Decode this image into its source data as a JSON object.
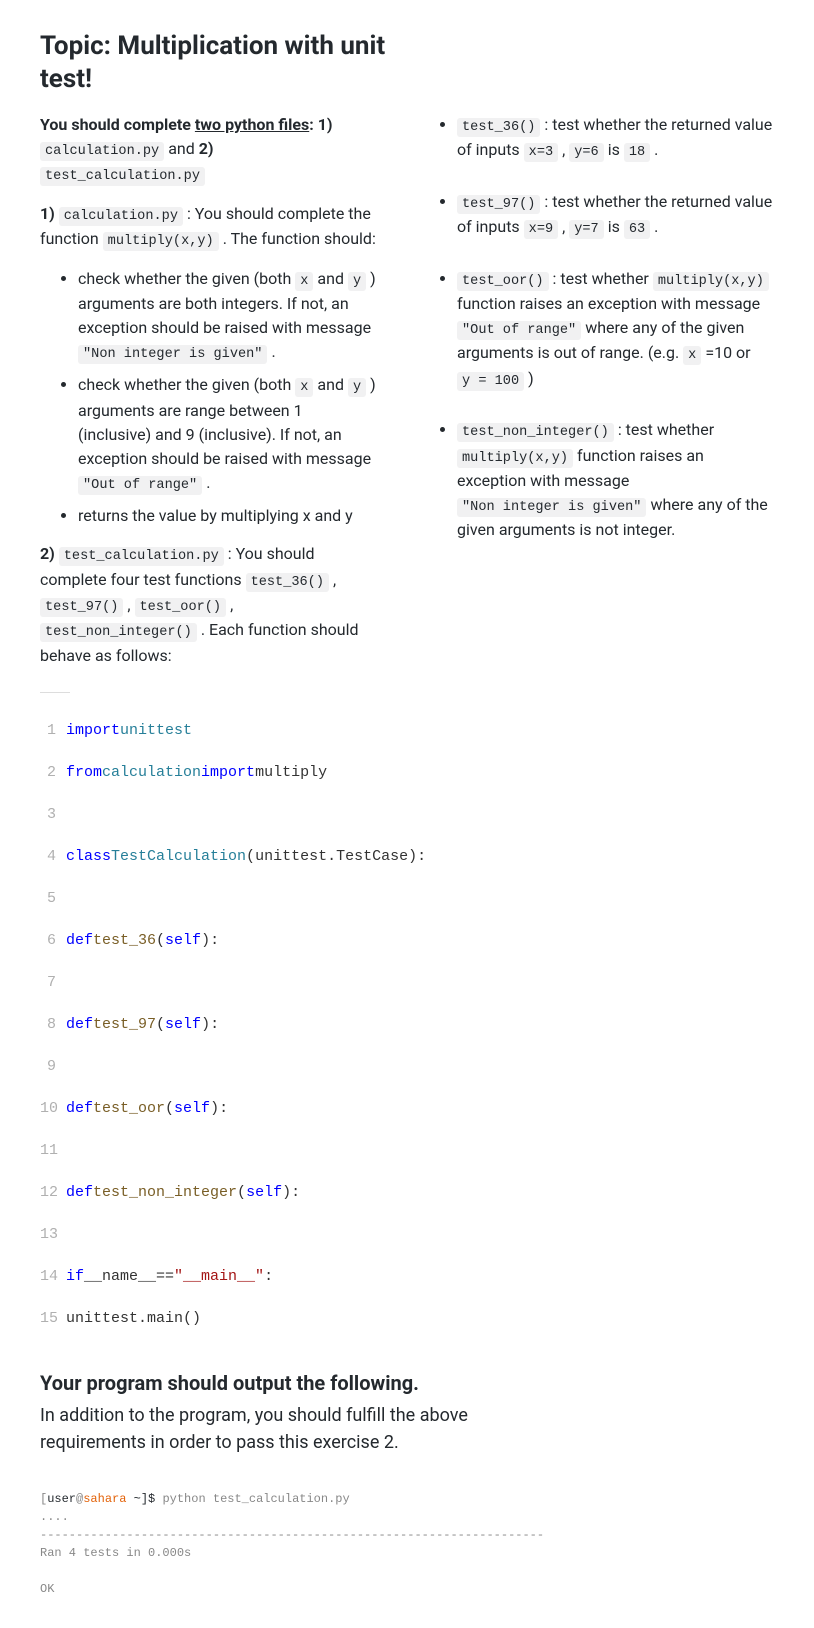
{
  "title": "Topic: Multiplication with unit test!",
  "intro": {
    "pre": "You should complete ",
    "u": "two python files",
    "post": ": 1)",
    "file1": "calculation.py",
    "mid": " and ",
    "post2": "2)",
    "file2": "test_calculation.py"
  },
  "part1": {
    "lead_num": "1)",
    "file": "calculation.py",
    "lead_txt": " : You should complete the function ",
    "fn": "multiply(x,y)",
    "lead_tail": " . The function should:",
    "b1a": "check whether the given (both ",
    "b1x": "x",
    "b1b": " and ",
    "b1y": "y",
    "b1c": " ) arguments are both integers. If not, an exception should be raised with message ",
    "b1msg": "\"Non integer is given\"",
    "b1d": " .",
    "b2a": "check whether the given (both ",
    "b2x": "x",
    "b2b": " and ",
    "b2y": "y",
    "b2c": " ) arguments are range between 1 (inclusive) and 9 (inclusive). If not, an exception should be raised with message ",
    "b2msg": "\"Out of range\"",
    "b2d": " .",
    "b3": "returns the value by multiplying x and y"
  },
  "part2": {
    "lead_num": "2)",
    "file": "test_calculation.py",
    "lead_txt": " : You should complete four test functions ",
    "f1": "test_36()",
    "c1": " , ",
    "f2": "test_97()",
    "c2": " , ",
    "f3": "test_oor()",
    "c3": " , ",
    "f4": "test_non_integer()",
    "tail": " . Each function should behave as follows:"
  },
  "tests": {
    "t1": {
      "name": "test_36()",
      "a": " : test whether the returned value of inputs ",
      "x": "x=3",
      "b": " , ",
      "y": "y=6",
      "c": " is ",
      "r": "18",
      "d": " ."
    },
    "t2": {
      "name": "test_97()",
      "a": " : test whether the returned value of inputs ",
      "x": "x=9",
      "b": " , ",
      "y": "y=7",
      "c": " is ",
      "r": "63",
      "d": " ."
    },
    "t3": {
      "name": "test_oor()",
      "a": " : test whether ",
      "fn": "multiply(x,y)",
      "b": " function raises an exception with message ",
      "msg": "\"Out of range\"",
      "c": " where any of the given arguments is out of range. (e.g. ",
      "x": "x",
      "d": " =10 or ",
      "y": "y = 100",
      "e": " )"
    },
    "t4": {
      "name": "test_non_integer()",
      "a": " : test whether ",
      "fn": "multiply(x,y)",
      "b": " function raises an exception with message ",
      "msg": "\"Non integer is given\"",
      "c": " where any of the given arguments is not integer."
    }
  },
  "code": {
    "l1": {
      "kw1": "import",
      "mod": "unittest"
    },
    "l2": {
      "kw1": "from",
      "mod": "calculation",
      "kw2": "import",
      "name": "multiply"
    },
    "l4": {
      "kw": "class",
      "name": "TestCalculation",
      "base": "unittest.TestCase"
    },
    "l6": {
      "kw": "def",
      "name": "test_36",
      "arg": "self"
    },
    "l8": {
      "kw": "def",
      "name": "test_97",
      "arg": "self"
    },
    "l10": {
      "kw": "def",
      "name": "test_oor",
      "arg": "self"
    },
    "l12": {
      "kw": "def",
      "name": "test_non_integer",
      "arg": "self"
    },
    "l14": {
      "kw": "if",
      "name": "__name__",
      "op": "==",
      "str": "\"__main__\""
    },
    "l15": "unittest.main()"
  },
  "ln": {
    "1": "1",
    "2": "2",
    "3": "3",
    "4": "4",
    "5": "5",
    "6": "6",
    "7": "7",
    "8": "8",
    "9": "9",
    "10": "10",
    "11": "11",
    "12": "12",
    "13": "13",
    "14": "14",
    "15": "15"
  },
  "output_head": "Your program should output the following.",
  "output_desc": "In addition to the program, you should fulfill the above requirements in order to pass this exercise 2.",
  "terminal": {
    "user": "user",
    "at": "@",
    "host": "sahara",
    "prompt": " ~]$ ",
    "cmd": "python test_calculation.py",
    "dots": "....",
    "sep": "----------------------------------------------------------------------",
    "ran": "Ran 4 tests in 0.000s",
    "ok": "OK"
  }
}
